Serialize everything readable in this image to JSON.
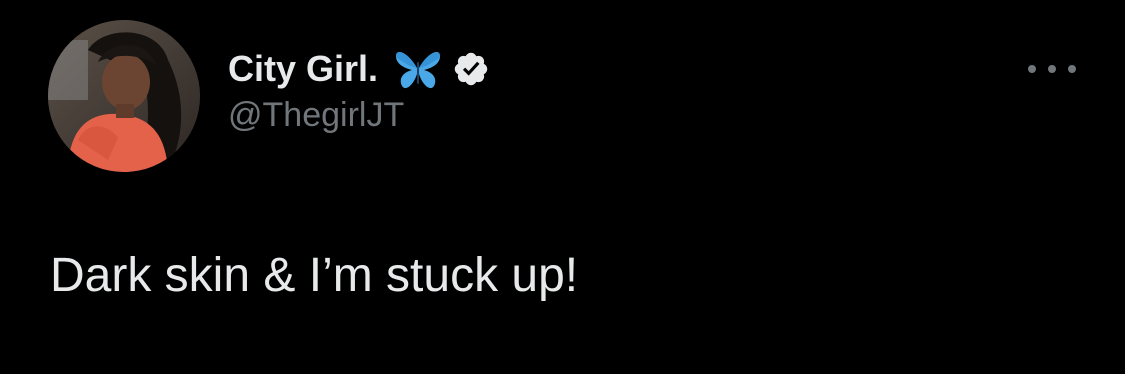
{
  "tweet": {
    "author": {
      "display_name": "City Girl.",
      "handle": "@ThegirlJT",
      "name_emoji": "butterfly-icon",
      "verified": true,
      "avatar": "profile-photo"
    },
    "text": "Dark skin & I’m stuck up!",
    "more_menu_icon": "more-horizontal-icon"
  },
  "colors": {
    "background": "#000000",
    "primary_text": "#e7e9ea",
    "secondary_text": "#71767b",
    "butterfly": "#4aa8e8",
    "verified_badge": "#e7e9ea"
  }
}
